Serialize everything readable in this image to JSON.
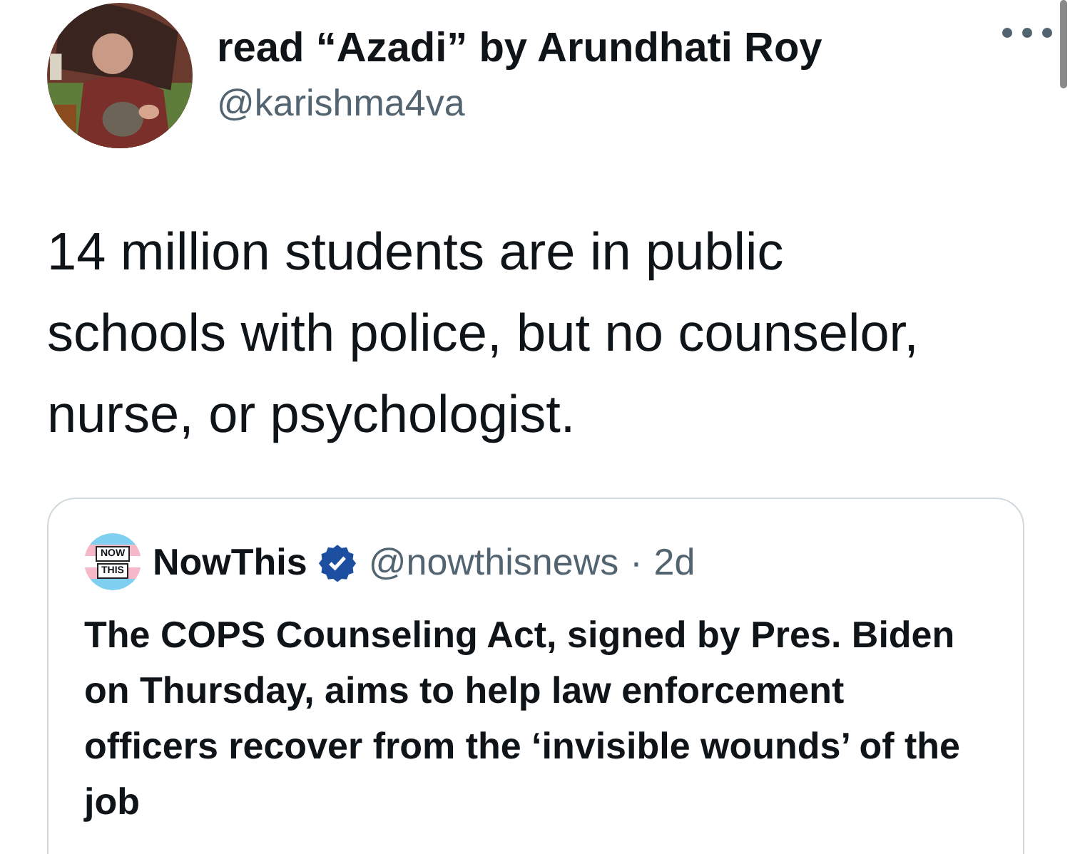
{
  "author": {
    "name": "read “Azadi” by Arundhati Roy",
    "handle": "@karishma4va"
  },
  "tweet_text": "14 million students are in public schools with police, but no counselor, nurse, or psychologist.",
  "quoted_tweet": {
    "logo_lines": [
      "NOW",
      "THIS"
    ],
    "name": "NowThis",
    "verified": true,
    "handle": "@nowthisnews",
    "separator": "·",
    "time": "2d",
    "text": "The COPS Counseling Act, signed by Pres. Biden on Thursday, aims to help law enforcement officers recover from the ‘invisible wounds’ of the job"
  }
}
